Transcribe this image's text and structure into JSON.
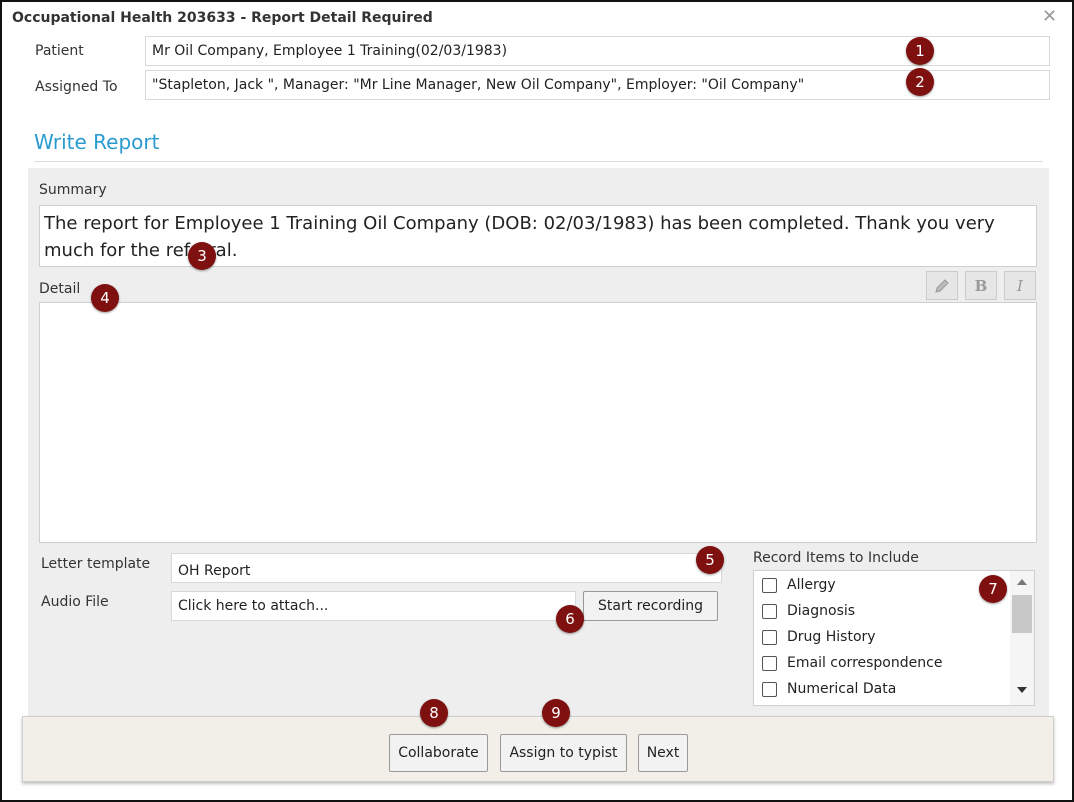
{
  "dialog": {
    "title": "Occupational Health 203633 - Report Detail Required",
    "close_icon": "close-icon"
  },
  "patient": {
    "label": "Patient",
    "value": "Mr Oil Company, Employee 1 Training(02/03/1983)"
  },
  "assigned": {
    "label": "Assigned To",
    "value": "\"Stapleton, Jack \", Manager: \"Mr Line Manager, New Oil Company\", Employer: \"Oil Company\""
  },
  "section": {
    "title": "Write Report"
  },
  "summary": {
    "label": "Summary",
    "value": "The report for Employee 1 Training Oil Company (DOB: 02/03/1983) has been completed. Thank you very much for the referral."
  },
  "detail": {
    "label": "Detail",
    "value": "",
    "toolbar": {
      "pencil_icon": "pencil-icon",
      "bold_label": "B",
      "italic_label": "I"
    }
  },
  "letter_template": {
    "label": "Letter template",
    "value": "OH Report"
  },
  "audio": {
    "label": "Audio File",
    "placeholder": "Click here to attach...",
    "record_button": "Start recording"
  },
  "record_items": {
    "label": "Record Items to Include",
    "items": [
      {
        "label": "Allergy",
        "checked": false
      },
      {
        "label": "Diagnosis",
        "checked": false
      },
      {
        "label": "Drug History",
        "checked": false
      },
      {
        "label": "Email correspondence",
        "checked": false
      },
      {
        "label": "Numerical Data",
        "checked": false
      }
    ]
  },
  "footer": {
    "collaborate": "Collaborate",
    "assign_typist": "Assign to typist",
    "next": "Next"
  },
  "markers": [
    "1",
    "2",
    "3",
    "4",
    "5",
    "6",
    "7",
    "8",
    "9"
  ],
  "colors": {
    "accent": "#2a9bd0",
    "marker": "#7f1010",
    "panel": "#eeeeee",
    "footer": "#f1efe8"
  }
}
